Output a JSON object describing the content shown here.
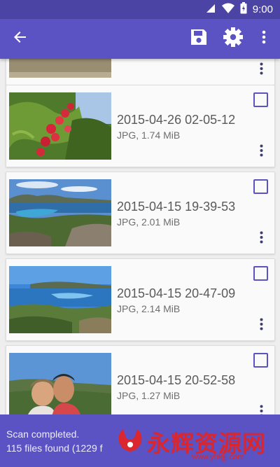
{
  "status_bar": {
    "time": "9:00"
  },
  "toolbar": {
    "back_icon": "arrow-back-icon",
    "save_icon": "save-icon",
    "settings_icon": "gear-icon",
    "overflow_icon": "more-vert-icon"
  },
  "files": [
    {
      "title": "2015-04-26 02-05-12",
      "info": "JPG, 1.74 MiB",
      "checked": false
    },
    {
      "title": "2015-04-15 19-39-53",
      "info": "JPG, 2.01 MiB",
      "checked": false
    },
    {
      "title": "2015-04-15 20-47-09",
      "info": "JPG, 2.14 MiB",
      "checked": false
    },
    {
      "title": "2015-04-15 20-52-58",
      "info": "JPG, 1.27 MiB",
      "checked": false
    }
  ],
  "snackbar": {
    "line1": "Scan completed.",
    "line2": "115 files found (1229 f"
  },
  "watermark": {
    "text": "永辉资源网",
    "url": "www.yhkjjj.com"
  },
  "colors": {
    "primary": "#5b52c4",
    "status_bar": "#4c44a4",
    "accent": "#5b52c4",
    "watermark": "#d9262f"
  }
}
